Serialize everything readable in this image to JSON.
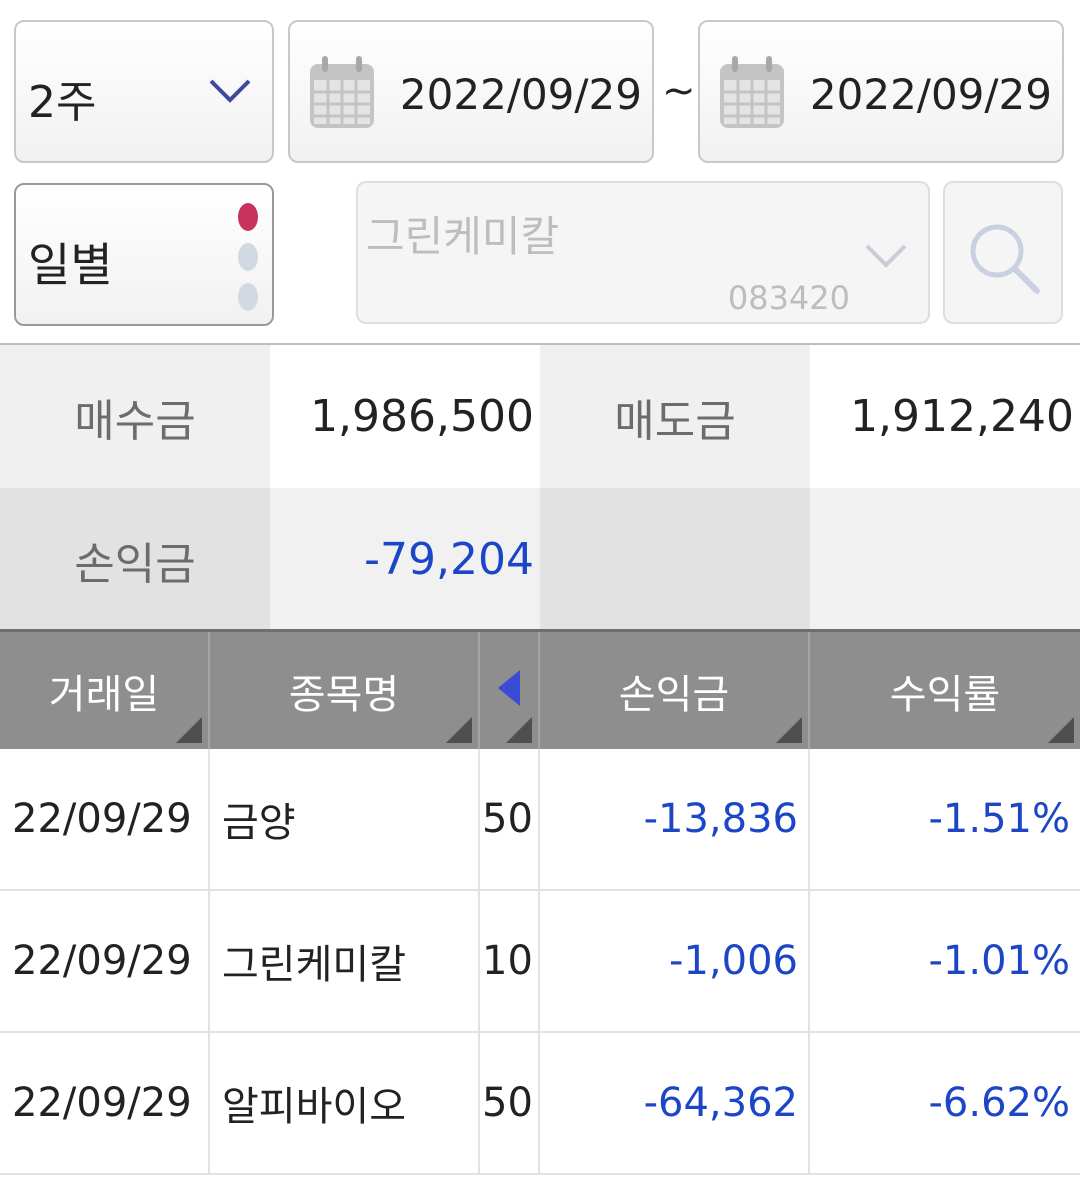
{
  "filters": {
    "period_label": "2주",
    "start_date": "2022/09/29",
    "range_separator": "~",
    "end_date": "2022/09/29",
    "mode_label": "일별",
    "stock_name": "그린케미칼",
    "stock_code": "083420"
  },
  "summary": {
    "buy_label": "매수금",
    "buy_value": "1,986,500",
    "sell_label": "매도금",
    "sell_value": "1,912,240",
    "pnl_label": "손익금",
    "pnl_value": "-79,204"
  },
  "table": {
    "headers": [
      "거래일",
      "종목명",
      "손익금",
      "수익률"
    ],
    "rows": [
      {
        "date": "22/09/29",
        "name": "금양",
        "qty": "50",
        "pnl": "-13,836",
        "rate": "-1.51%"
      },
      {
        "date": "22/09/29",
        "name": "그린케미칼",
        "qty": "10",
        "pnl": "-1,006",
        "rate": "-1.01%"
      },
      {
        "date": "22/09/29",
        "name": "알피바이오",
        "qty": "50",
        "pnl": "-64,362",
        "rate": "-6.62%"
      }
    ]
  },
  "colors": {
    "negative": "#1c46c6",
    "active_dot": "#c8325f",
    "header_bg": "#8e8e8e"
  },
  "icons": [
    "chevron-down-icon",
    "calendar-icon",
    "search-icon",
    "caret-left-icon"
  ]
}
